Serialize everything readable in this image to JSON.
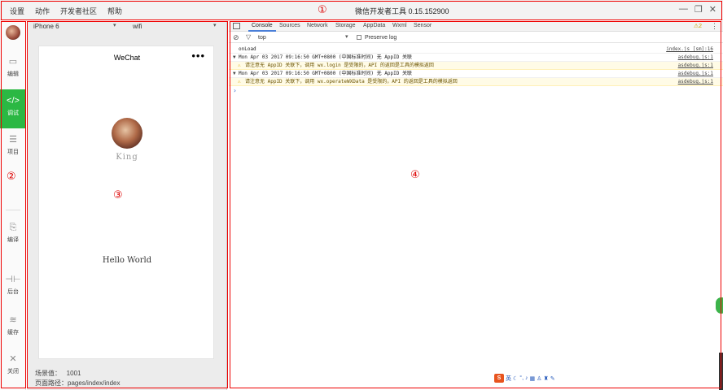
{
  "menu": [
    "设置",
    "动作",
    "开发者社区",
    "帮助"
  ],
  "app_title": "微信开发者工具 0.15.152900",
  "window_controls": [
    "minimize-icon",
    "restore-icon",
    "close-icon"
  ],
  "markers": {
    "m1": "①",
    "m2": "②",
    "m3": "③",
    "m4": "④"
  },
  "sidebar": {
    "items": [
      {
        "icon": "editor-icon",
        "glyph": "▭",
        "label": "编辑"
      },
      {
        "icon": "debug-icon",
        "glyph": "</>",
        "label": "调试"
      },
      {
        "icon": "project-icon",
        "glyph": "☰",
        "label": "项目"
      },
      {
        "icon": "compile-icon",
        "glyph": "⎘",
        "label": "编译"
      },
      {
        "icon": "background-icon",
        "glyph": "⊣⊢",
        "label": "后台"
      },
      {
        "icon": "cache-icon",
        "glyph": "≋",
        "label": "缓存"
      },
      {
        "icon": "close-icon",
        "glyph": "✕",
        "label": "关闭"
      }
    ]
  },
  "simulator": {
    "device": "iPhone 6",
    "network": "wifi",
    "phone_title": "WeChat",
    "phone_menu": "•••",
    "user_name": "King",
    "hello": "Hello World",
    "scene_label": "场景值：",
    "scene_value": "1001",
    "path_label": "页面路径：",
    "path_value": "pages/index/index"
  },
  "devtools": {
    "tabs": [
      "Console",
      "Sources",
      "Network",
      "Storage",
      "AppData",
      "Wxml",
      "Sensor"
    ],
    "active_tab": "Console",
    "warning_count": "2",
    "context": "top",
    "preserve_log": "Preserve log",
    "logs": [
      {
        "type": "log",
        "msg": "onLoad",
        "src": "index.js [sm]:16"
      },
      {
        "type": "group",
        "msg": "Mon Apr 03 2017 09:16:50 GMT+0800 (中国标准时间) 无 AppID 关联",
        "src": "asdebug.js:1"
      },
      {
        "type": "warn",
        "msg": "请注意无 AppID 关联下，调用 wx.login 是受限的，API 的返回是工具的模拟返回",
        "src": "asdebug.js:1"
      },
      {
        "type": "group",
        "msg": "Mon Apr 03 2017 09:16:50 GMT+0800 (中国标准时间) 无 AppID 关联",
        "src": "asdebug.js:1"
      },
      {
        "type": "warn",
        "msg": "请注意无 AppID 关联下，调用 wx.operateWXData 是受限的，API 的返回是工具的模拟返回",
        "src": "asdebug.js:1"
      }
    ],
    "prompt": "›"
  },
  "ime": {
    "logo": "S",
    "label": "英"
  }
}
